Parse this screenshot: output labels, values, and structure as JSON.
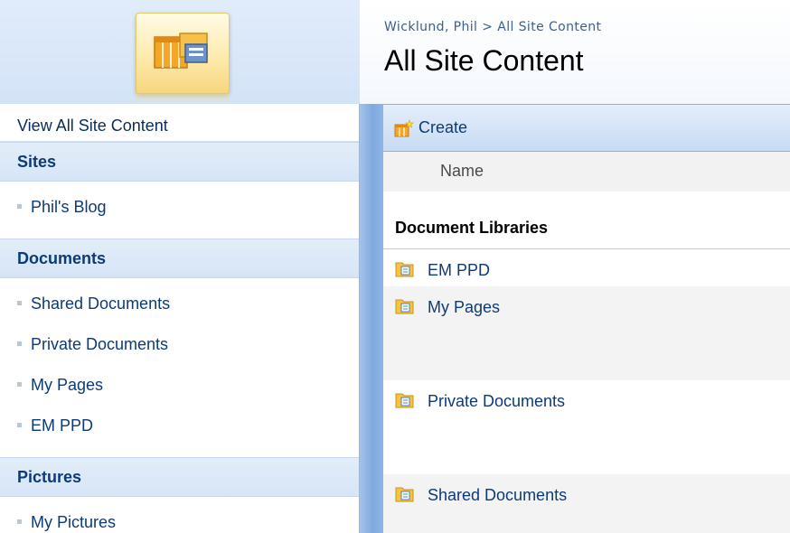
{
  "header": {
    "breadcrumb_site": "Wicklund, Phil",
    "breadcrumb_sep": ">",
    "breadcrumb_current": "All Site Content",
    "page_title": "All Site Content"
  },
  "nav": {
    "view_all": "View All Site Content",
    "sections": [
      {
        "title": "Sites",
        "items": [
          "Phil's Blog"
        ]
      },
      {
        "title": "Documents",
        "items": [
          "Shared Documents",
          "Private Documents",
          "My Pages",
          "EM PPD"
        ]
      },
      {
        "title": "Pictures",
        "items": [
          "My Pictures"
        ]
      }
    ]
  },
  "toolbar": {
    "create_label": "Create",
    "icon": "create-list-icon"
  },
  "list": {
    "column_name": "Name",
    "section_title": "Document Libraries",
    "items": [
      "EM PPD",
      "My Pages",
      "Private Documents",
      "Shared Documents"
    ],
    "item_icon": "document-library-icon"
  },
  "colors": {
    "link": "#0c3b78",
    "nav_header_bg": "#d6e5f7",
    "toolbar_bg": "#c7dbf4",
    "logo_bg": "#fde8a8"
  }
}
